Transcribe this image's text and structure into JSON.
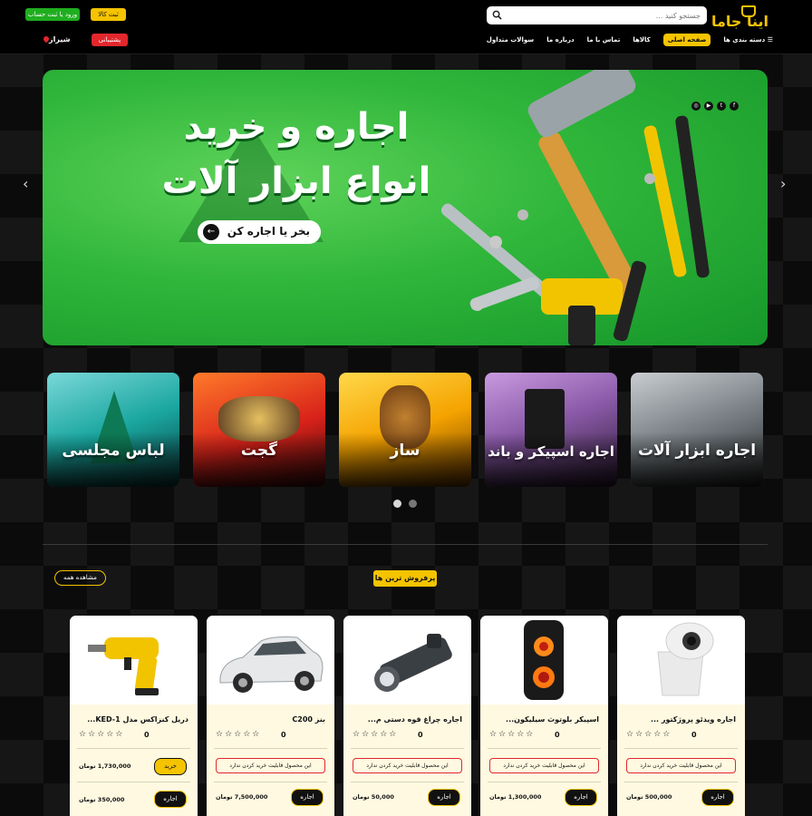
{
  "header": {
    "logo_text": "اینا جاما",
    "search_placeholder": "جستجو کنید ...",
    "sell_button": "ثبت کالا",
    "login_button": "ورود یا ثبت حساب",
    "support_button": "پشتیبانی",
    "city": "شیراز",
    "nav": {
      "categories": "دسته بندی ها",
      "home": "صفحه اصلی",
      "products": "کالاها",
      "contact": "تماس با ما",
      "about": "درباره ما",
      "faq": "سوالات متداول"
    }
  },
  "banner": {
    "title_line1": "اجاره و خرید",
    "title_line2": "انواع ابزار آلات",
    "cta": "بخر یا اجاره کن",
    "socials": [
      "instagram-icon",
      "youtube-icon",
      "twitter-icon",
      "facebook-icon"
    ]
  },
  "categories": [
    {
      "label": "اجاره ابزار آلات"
    },
    {
      "label": "اجاره اسپیکر و باند"
    },
    {
      "label": "ساز"
    },
    {
      "label": "گجت"
    },
    {
      "label": "لباس مجلسی"
    }
  ],
  "section": {
    "title": "پرفروش ترین ها",
    "view_all": "مشاهده همه"
  },
  "products": [
    {
      "name": "اجاره ویدئو پروژکتور ...",
      "rating": "0",
      "notice": "این محصول قابلیت خرید کردن ندارد",
      "rent_price": "500,000 تومان",
      "rent_label": "اجاره"
    },
    {
      "name": "اسپیکر بلوتوث سیلیکون...",
      "rating": "0",
      "notice": "این محصول قابلیت خرید کردن ندارد",
      "rent_price": "1,300,000 تومان",
      "rent_label": "اجاره"
    },
    {
      "name": "اجاره چراغ قوه دستی م...",
      "rating": "0",
      "notice": "این محصول قابلیت خرید کردن ندارد",
      "rent_price": "50,000 تومان",
      "rent_label": "اجاره"
    },
    {
      "name": "بنز C200",
      "rating": "0",
      "notice": "این محصول قابلیت خرید کردن ندارد",
      "rent_price": "7,500,000 تومان",
      "rent_label": "اجاره"
    },
    {
      "name": "دریل کنزاکس مدل KED-1...",
      "rating": "0",
      "buy_price": "1,730,000 تومان",
      "buy_label": "خرید",
      "rent_price": "350,000 تومان",
      "rent_label": "اجاره"
    }
  ],
  "colors": {
    "accent": "#f5c400",
    "green": "#1fae1f",
    "red": "#e2272d"
  }
}
